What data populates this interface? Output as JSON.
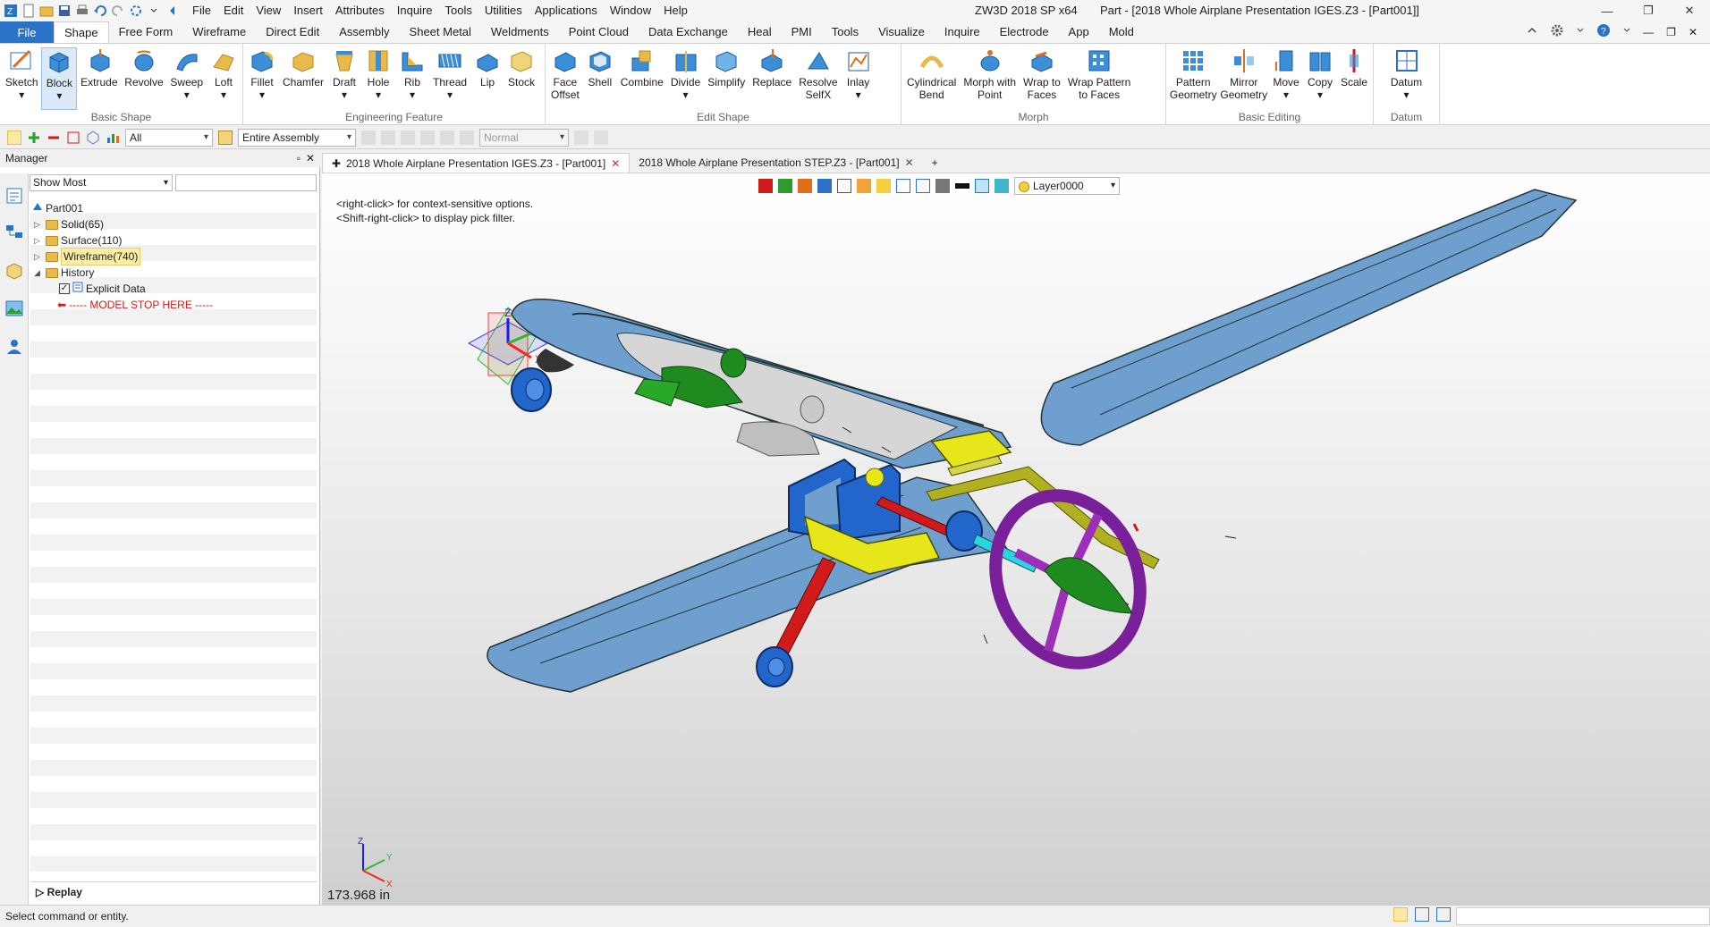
{
  "app": {
    "title": "ZW3D 2018 SP x64",
    "document_title": "Part - [2018 Whole Airplane Presentation IGES.Z3 - [Part001]]"
  },
  "menu": [
    "File",
    "Edit",
    "View",
    "Insert",
    "Attributes",
    "Inquire",
    "Tools",
    "Utilities",
    "Applications",
    "Window",
    "Help"
  ],
  "ribbon_tabs": {
    "file": "File",
    "tabs": [
      "Shape",
      "Free Form",
      "Wireframe",
      "Direct Edit",
      "Assembly",
      "Sheet Metal",
      "Weldments",
      "Point Cloud",
      "Data Exchange",
      "Heal",
      "PMI",
      "Tools",
      "Visualize",
      "Inquire",
      "Electrode",
      "App",
      "Mold"
    ],
    "active": "Shape"
  },
  "ribbon": {
    "basic_shape": {
      "name": "Basic Shape",
      "buttons": [
        "Sketch",
        "Block",
        "Extrude",
        "Revolve",
        "Sweep",
        "Loft"
      ]
    },
    "engineering_feature": {
      "name": "Engineering Feature",
      "buttons": [
        "Fillet",
        "Chamfer",
        "Draft",
        "Hole",
        "Rib",
        "Thread",
        "Lip",
        "Stock"
      ]
    },
    "edit_shape": {
      "name": "Edit Shape",
      "face_offset": [
        "Face",
        "Offset"
      ],
      "buttons": [
        "Shell",
        "Combine",
        "Divide",
        "Simplify",
        "Replace"
      ],
      "resolve": [
        "Resolve",
        "SelfX"
      ],
      "inlay": "Inlay"
    },
    "morph": {
      "name": "Morph",
      "cyl_bend": [
        "Cylindrical",
        "Bend"
      ],
      "morph_point": [
        "Morph with",
        "Point"
      ],
      "wrap_faces": [
        "Wrap to",
        "Faces"
      ],
      "wrap_pattern": [
        "Wrap Pattern",
        "to Faces"
      ]
    },
    "basic_editing": {
      "name": "Basic Editing",
      "pattern": [
        "Pattern",
        "Geometry"
      ],
      "mirror": [
        "Mirror",
        "Geometry"
      ],
      "buttons": [
        "Move",
        "Copy",
        "Scale"
      ]
    },
    "datum": {
      "name": "Datum",
      "button": "Datum"
    }
  },
  "toolbar": {
    "filter": "All",
    "assembly": "Entire Assembly",
    "mode": "Normal"
  },
  "manager": {
    "title": "Manager",
    "filter": "Show Most",
    "tree": {
      "root": "Part001",
      "solid": "Solid(65)",
      "surface": "Surface(110)",
      "wireframe": "Wireframe(740)",
      "history": "History",
      "explicit": "Explicit Data",
      "stop": "----- MODEL STOP HERE -----"
    },
    "replay": "Replay"
  },
  "doc_tabs": [
    {
      "label": "2018 Whole Airplane Presentation IGES.Z3 - [Part001]",
      "active": true
    },
    {
      "label": "2018 Whole Airplane Presentation STEP.Z3 - [Part001]",
      "active": false
    }
  ],
  "viewport": {
    "hint_1": "<right-click> for context-sensitive options.",
    "hint_2": "<Shift-right-click> to display pick filter.",
    "layer": "Layer0000",
    "scale": "173.968 in",
    "axis_x": "X",
    "axis_y": "Y",
    "axis_z": "Z"
  },
  "status": {
    "text": "Select command or entity."
  },
  "colors": {
    "file_tab": "#2b73c9",
    "wing_blue": "#6f9fcf",
    "pilot_green": "#1f8a1f",
    "accent_yellow": "#e6e61a",
    "prop_purple": "#9b2fb8",
    "strut_red": "#d11a1a"
  }
}
